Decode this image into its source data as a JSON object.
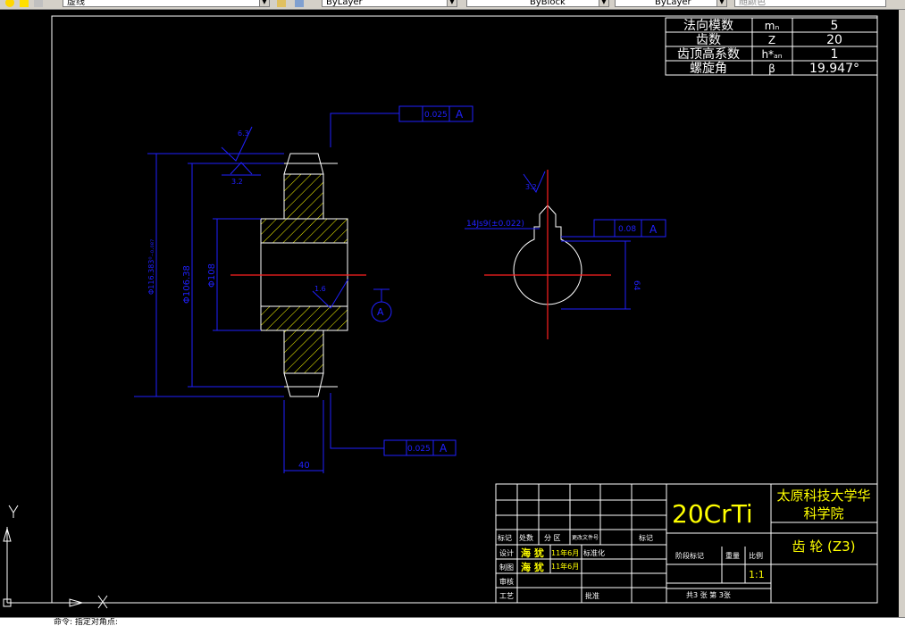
{
  "toolbar": {
    "linetype": "虚线",
    "layer": "ByLayer",
    "linetype_combo": "ByBlock",
    "lineweight": "ByLayer",
    "color": "随颜色"
  },
  "params_table": {
    "rows": [
      {
        "name": "法向模数",
        "symbol": "mₙ",
        "value": "5"
      },
      {
        "name": "齿数",
        "symbol": "Z",
        "value": "20"
      },
      {
        "name": "齿顶高系数",
        "symbol": "h*ₐₙ",
        "value": "1"
      },
      {
        "name": "螺旋角",
        "symbol": "β",
        "value": "19.947°"
      }
    ]
  },
  "dimensions": {
    "tol_top_value": "0.025",
    "tol_top_datum": "A",
    "tol_bottom_value": "0.025",
    "tol_bottom_datum": "A",
    "tol_right_value": "0.08",
    "tol_right_datum": "A",
    "dia_outer": "Φ116.383⁰₋₀.₀₈₇",
    "dia_pitch": "Φ106.38",
    "dia_hub": "Φ108",
    "width": "40",
    "rough_top": "6.3",
    "rough_mid": "3.2",
    "rough_bore": "1.6",
    "rough_key": "3.2",
    "keyway": "14Js9(±0.022)",
    "key_depth": "64",
    "datum_label": "A"
  },
  "title_block": {
    "material": "20CrTi",
    "institution": "太原科技大学华科学院",
    "part_name": "齿 轮 (Z3)",
    "scale_label": "比例",
    "scale_value": "1:1",
    "stage_label": "阶段标记",
    "weight_label": "重量",
    "sheets": "共3 张  第 3张",
    "mark_label": "标记",
    "count_label": "处数",
    "zone_label": "分 区",
    "change_label": "更改文件号",
    "sign_label": "签名",
    "date_label": "年月日",
    "design_label": "设计",
    "draw_label": "制图",
    "review_label": "审核",
    "process_label": "工艺",
    "std_label": "标准化",
    "approve_label": "批准",
    "date_design": "11年6月",
    "date_draw": "11年6月"
  },
  "ucs": {
    "x": "X",
    "y": "Y"
  },
  "command_line": "命令: 指定对角点:"
}
